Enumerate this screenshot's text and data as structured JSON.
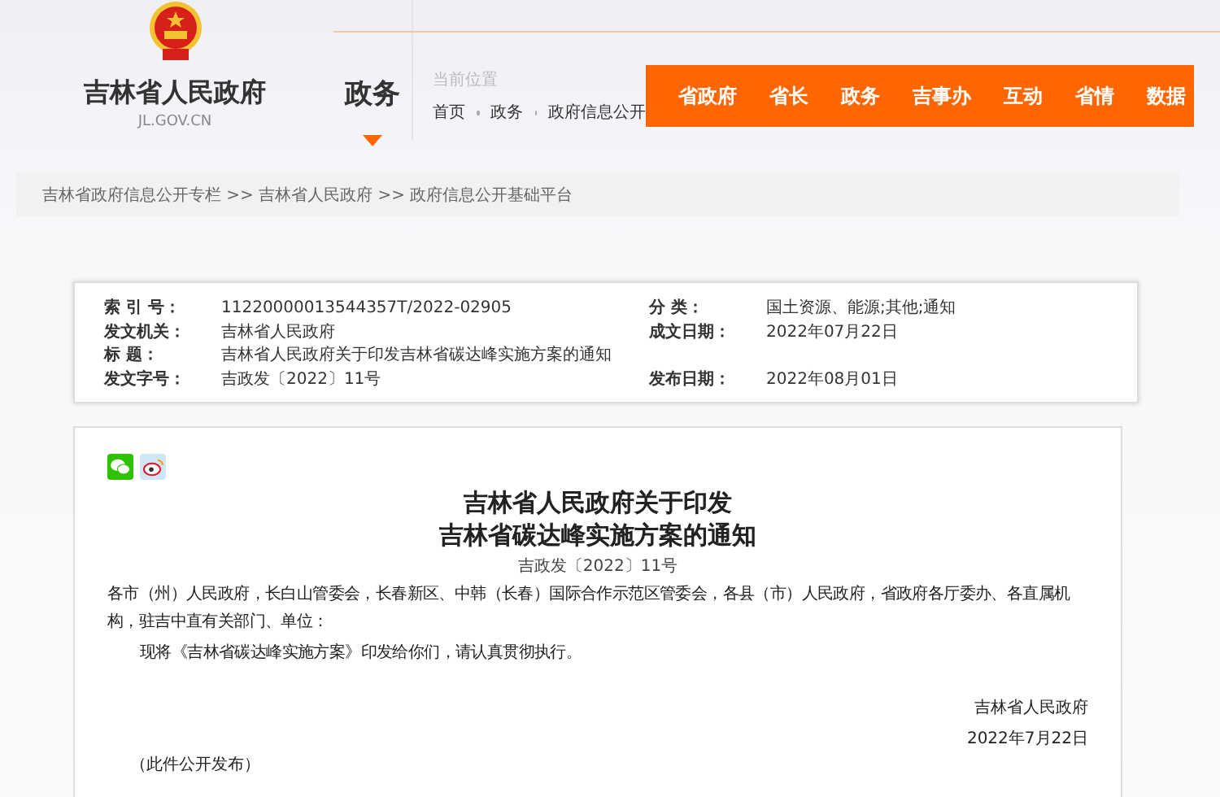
{
  "header": {
    "site_name": "吉林省人民政府",
    "domain": "JL.GOV.CN",
    "section": "政务",
    "location_label": "当前位置",
    "location_path": [
      "首页",
      "政务",
      "政府信息公开"
    ],
    "nav": [
      "省政府",
      "省长",
      "政务",
      "吉事办",
      "互动",
      "省情",
      "数据"
    ]
  },
  "breadcrumb": "吉林省政府信息公开专栏 >> 吉林省人民政府 >> 政府信息公开基础平台",
  "info": [
    {
      "left": {
        "label": "索 引 号：",
        "value": "11220000013544357T/2022-02905"
      },
      "right": {
        "label": "分 类：",
        "value": "国土资源、能源;其他;通知"
      }
    },
    {
      "left": {
        "label": "发文机关：",
        "value": "吉林省人民政府"
      },
      "right": {
        "label": "成文日期：",
        "value": "2022年07月22日"
      }
    },
    {
      "left": {
        "label": "标 题：",
        "value": "吉林省人民政府关于印发吉林省碳达峰实施方案的通知"
      }
    },
    {
      "left": {
        "label": "发文字号：",
        "value": "吉政发〔2022〕11号"
      },
      "right": {
        "label": "发布日期：",
        "value": "2022年08月01日"
      }
    }
  ],
  "article": {
    "title_lines": [
      "吉林省人民政府关于印发",
      "吉林省碳达峰实施方案的通知"
    ],
    "doc_number": "吉政发〔2022〕11号",
    "paragraphs": [
      {
        "kind": "address",
        "text": "各市（州）人民政府，长白山管委会，长春新区、中韩（长春）国际合作示范区管委会，各县（市）人民政府，省政府各厅委办、各直属机构，驻吉中直有关部门、单位："
      },
      {
        "kind": "body",
        "text": "现将《吉林省碳达峰实施方案》印发给你们，请认真贯彻执行。"
      }
    ],
    "signature": "吉林省人民政府",
    "date": "2022年7月22日",
    "note": "（此件公开发布）"
  }
}
